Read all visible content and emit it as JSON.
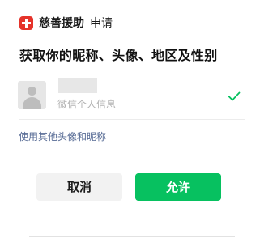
{
  "header": {
    "app_name": "慈善援助",
    "request_label": "申请",
    "logo_color": "#e5332b"
  },
  "title": "获取你的昵称、头像、地区及性别",
  "profile": {
    "info_label": "微信个人信息",
    "avatar_icon": "default-avatar-icon",
    "selected_icon": "check-icon",
    "check_color": "#07c160"
  },
  "alt_link": "使用其他头像和昵称",
  "buttons": {
    "cancel": "取消",
    "allow": "允许",
    "allow_color": "#07c160"
  }
}
